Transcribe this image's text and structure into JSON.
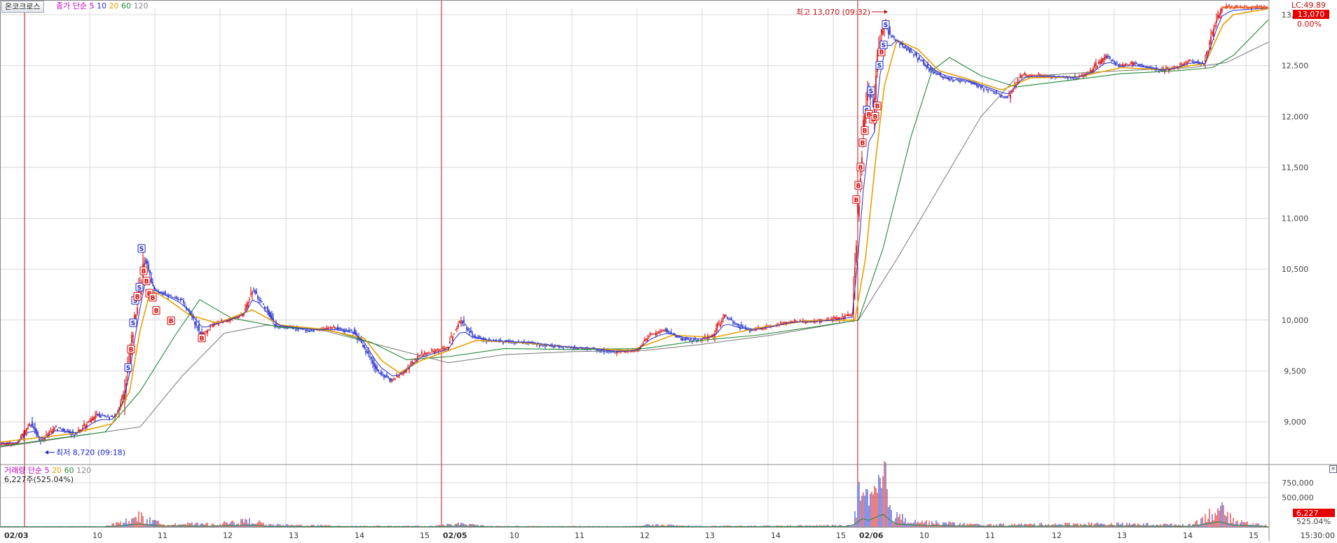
{
  "colors": {
    "up": "#d40000",
    "down": "#1a24c8",
    "ma5": "#2a2ed0",
    "ma10": "#d4d4d4",
    "ma20": "#e8a000",
    "ma60": "#22893a",
    "ma120": "#777777",
    "grid": "#d8d8d8",
    "day_line": "#c01010"
  },
  "price_panel": {
    "stock_button": "온코크로스",
    "legend": {
      "prefix": "종가",
      "type": "단순",
      "periods": [
        "5",
        "10",
        "20",
        "60",
        "120"
      ]
    },
    "right_top_label": "LC:49.89",
    "current_price_tag": "13,070",
    "current_pct": "0.00%",
    "high_label": "최고 13,070 (09:32)",
    "low_label": "최저 8,720 (09:18)"
  },
  "volume_panel": {
    "legend": {
      "prefix": "거래량",
      "type": "단순",
      "periods": [
        "5",
        "20",
        "60",
        "120"
      ]
    },
    "current_text": "6,227주(525.04%)",
    "tag_value": "6,227",
    "tag_pct": "525.04%"
  },
  "footer": {
    "end_time": "15:30:00"
  },
  "chart_data": {
    "type": "candlestick",
    "interval": "1-minute intraday (3 sessions)",
    "y_ticks": [
      9000,
      9500,
      10000,
      10500,
      11000,
      11500,
      12000,
      12500,
      13000
    ],
    "y_tick_labels": [
      "9,000",
      "9,500",
      "10,000",
      "10,500",
      "11,000",
      "11,500",
      "12,000",
      "12,500",
      "13,000"
    ],
    "ylim": [
      8600,
      13180
    ],
    "volume_ticks": [
      500000,
      750000
    ],
    "volume_tick_labels": [
      "500,000",
      "750,000"
    ],
    "volume_max": 1000000,
    "x_labels": [
      "02/03",
      "10",
      "11",
      "12",
      "13",
      "14",
      "15",
      "02/05",
      "10",
      "11",
      "12",
      "13",
      "14",
      "15",
      "02/06",
      "10",
      "11",
      "12",
      "13",
      "14",
      "15"
    ],
    "sessions": [
      "02/03",
      "02/05",
      "02/06"
    ],
    "high": {
      "value": 13070,
      "time": "09:32",
      "date": "02/06"
    },
    "low": {
      "value": 8720,
      "time": "09:18",
      "date": "02/03"
    },
    "price_path": [
      [
        0,
        8780
      ],
      [
        25,
        8780
      ],
      [
        45,
        8990
      ],
      [
        60,
        8800
      ],
      [
        80,
        8950
      ],
      [
        110,
        8880
      ],
      [
        140,
        9070
      ],
      [
        165,
        9050
      ],
      [
        178,
        9250
      ],
      [
        192,
        9950
      ],
      [
        202,
        10350
      ],
      [
        207,
        10600
      ],
      [
        213,
        10500
      ],
      [
        222,
        10300
      ],
      [
        240,
        10250
      ],
      [
        260,
        10200
      ],
      [
        275,
        10050
      ],
      [
        290,
        9850
      ],
      [
        305,
        9950
      ],
      [
        330,
        10000
      ],
      [
        350,
        10050
      ],
      [
        362,
        10300
      ],
      [
        378,
        10150
      ],
      [
        395,
        9950
      ],
      [
        420,
        9920
      ],
      [
        450,
        9900
      ],
      [
        480,
        9920
      ],
      [
        505,
        9900
      ],
      [
        520,
        9750
      ],
      [
        540,
        9500
      ],
      [
        560,
        9400
      ],
      [
        580,
        9500
      ],
      [
        600,
        9650
      ],
      [
        620,
        9690
      ],
      [
        640,
        9720
      ],
      [
        650,
        9900
      ],
      [
        660,
        10000
      ],
      [
        675,
        9850
      ],
      [
        700,
        9800
      ],
      [
        730,
        9790
      ],
      [
        760,
        9780
      ],
      [
        800,
        9740
      ],
      [
        850,
        9720
      ],
      [
        880,
        9680
      ],
      [
        910,
        9700
      ],
      [
        930,
        9850
      ],
      [
        950,
        9900
      ],
      [
        975,
        9820
      ],
      [
        1000,
        9800
      ],
      [
        1020,
        9850
      ],
      [
        1035,
        10050
      ],
      [
        1055,
        9950
      ],
      [
        1075,
        9900
      ],
      [
        1100,
        9930
      ],
      [
        1130,
        9980
      ],
      [
        1160,
        9980
      ],
      [
        1190,
        10000
      ],
      [
        1218,
        10050
      ],
      [
        1225,
        11000
      ],
      [
        1232,
        11800
      ],
      [
        1240,
        12300
      ],
      [
        1248,
        12100
      ],
      [
        1255,
        12700
      ],
      [
        1265,
        12950
      ],
      [
        1272,
        12800
      ],
      [
        1290,
        12700
      ],
      [
        1310,
        12600
      ],
      [
        1330,
        12450
      ],
      [
        1350,
        12380
      ],
      [
        1380,
        12350
      ],
      [
        1400,
        12300
      ],
      [
        1420,
        12250
      ],
      [
        1440,
        12180
      ],
      [
        1460,
        12400
      ],
      [
        1500,
        12400
      ],
      [
        1540,
        12380
      ],
      [
        1560,
        12450
      ],
      [
        1580,
        12600
      ],
      [
        1600,
        12500
      ],
      [
        1620,
        12520
      ],
      [
        1660,
        12450
      ],
      [
        1680,
        12480
      ],
      [
        1700,
        12550
      ],
      [
        1720,
        12520
      ],
      [
        1735,
        12900
      ],
      [
        1745,
        13070
      ],
      [
        1810,
        13070
      ]
    ],
    "ma20_path": [
      [
        0,
        8800
      ],
      [
        100,
        8880
      ],
      [
        160,
        8980
      ],
      [
        185,
        9300
      ],
      [
        200,
        9900
      ],
      [
        215,
        10300
      ],
      [
        240,
        10200
      ],
      [
        270,
        10050
      ],
      [
        310,
        9970
      ],
      [
        360,
        10100
      ],
      [
        400,
        9950
      ],
      [
        460,
        9910
      ],
      [
        520,
        9820
      ],
      [
        545,
        9600
      ],
      [
        570,
        9480
      ],
      [
        600,
        9600
      ],
      [
        640,
        9700
      ],
      [
        680,
        9800
      ],
      [
        740,
        9780
      ],
      [
        820,
        9730
      ],
      [
        900,
        9700
      ],
      [
        960,
        9850
      ],
      [
        1020,
        9830
      ],
      [
        1080,
        9920
      ],
      [
        1150,
        9990
      ],
      [
        1220,
        10000
      ],
      [
        1235,
        10600
      ],
      [
        1250,
        11600
      ],
      [
        1262,
        12300
      ],
      [
        1280,
        12750
      ],
      [
        1310,
        12660
      ],
      [
        1340,
        12450
      ],
      [
        1380,
        12370
      ],
      [
        1430,
        12260
      ],
      [
        1470,
        12380
      ],
      [
        1540,
        12390
      ],
      [
        1600,
        12480
      ],
      [
        1660,
        12460
      ],
      [
        1720,
        12520
      ],
      [
        1745,
        12900
      ],
      [
        1760,
        13000
      ],
      [
        1810,
        13060
      ]
    ],
    "ma60_path": [
      [
        0,
        8760
      ],
      [
        150,
        8900
      ],
      [
        200,
        9300
      ],
      [
        250,
        9850
      ],
      [
        285,
        10200
      ],
      [
        330,
        10020
      ],
      [
        400,
        9930
      ],
      [
        470,
        9900
      ],
      [
        530,
        9780
      ],
      [
        580,
        9610
      ],
      [
        640,
        9640
      ],
      [
        720,
        9720
      ],
      [
        820,
        9710
      ],
      [
        920,
        9720
      ],
      [
        1000,
        9800
      ],
      [
        1080,
        9850
      ],
      [
        1160,
        9930
      ],
      [
        1225,
        10000
      ],
      [
        1260,
        10700
      ],
      [
        1300,
        11800
      ],
      [
        1330,
        12450
      ],
      [
        1355,
        12580
      ],
      [
        1400,
        12400
      ],
      [
        1450,
        12290
      ],
      [
        1520,
        12350
      ],
      [
        1600,
        12420
      ],
      [
        1680,
        12450
      ],
      [
        1730,
        12480
      ],
      [
        1760,
        12600
      ],
      [
        1810,
        12950
      ]
    ],
    "ma120_path": [
      [
        0,
        8750
      ],
      [
        200,
        8950
      ],
      [
        260,
        9450
      ],
      [
        320,
        9870
      ],
      [
        380,
        9950
      ],
      [
        460,
        9900
      ],
      [
        560,
        9720
      ],
      [
        640,
        9580
      ],
      [
        720,
        9660
      ],
      [
        820,
        9690
      ],
      [
        920,
        9700
      ],
      [
        1000,
        9760
      ],
      [
        1100,
        9850
      ],
      [
        1225,
        10000
      ],
      [
        1280,
        10600
      ],
      [
        1340,
        11300
      ],
      [
        1400,
        12000
      ],
      [
        1450,
        12380
      ],
      [
        1520,
        12420
      ],
      [
        1600,
        12450
      ],
      [
        1700,
        12480
      ],
      [
        1750,
        12530
      ],
      [
        1810,
        12730
      ]
    ],
    "volume_profile": [
      [
        0,
        8000
      ],
      [
        150,
        12000
      ],
      [
        185,
        120000
      ],
      [
        195,
        220000
      ],
      [
        205,
        160000
      ],
      [
        230,
        60000
      ],
      [
        300,
        50000
      ],
      [
        362,
        120000
      ],
      [
        380,
        40000
      ],
      [
        500,
        20000
      ],
      [
        620,
        15000
      ],
      [
        650,
        60000
      ],
      [
        700,
        15000
      ],
      [
        900,
        12000
      ],
      [
        930,
        40000
      ],
      [
        1000,
        15000
      ],
      [
        1100,
        20000
      ],
      [
        1218,
        30000
      ],
      [
        1225,
        600000
      ],
      [
        1240,
        450000
      ],
      [
        1262,
        900000
      ],
      [
        1275,
        200000
      ],
      [
        1320,
        90000
      ],
      [
        1400,
        40000
      ],
      [
        1560,
        60000
      ],
      [
        1700,
        40000
      ],
      [
        1740,
        350000
      ],
      [
        1760,
        120000
      ],
      [
        1810,
        20000
      ]
    ],
    "trade_markers": [
      {
        "kind": "S",
        "pos": 183,
        "price": 9530
      },
      {
        "kind": "B",
        "pos": 187,
        "price": 9710
      },
      {
        "kind": "S",
        "pos": 190,
        "price": 9970
      },
      {
        "kind": "S",
        "pos": 193,
        "price": 10190
      },
      {
        "kind": "B",
        "pos": 196,
        "price": 10230
      },
      {
        "kind": "S",
        "pos": 199,
        "price": 10320
      },
      {
        "kind": "S",
        "pos": 202,
        "price": 10700
      },
      {
        "kind": "B",
        "pos": 205,
        "price": 10480
      },
      {
        "kind": "B",
        "pos": 209,
        "price": 10380
      },
      {
        "kind": "B",
        "pos": 213,
        "price": 10260
      },
      {
        "kind": "B",
        "pos": 218,
        "price": 10220
      },
      {
        "kind": "B",
        "pos": 223,
        "price": 10090
      },
      {
        "kind": "B",
        "pos": 244,
        "price": 9990
      },
      {
        "kind": "B",
        "pos": 288,
        "price": 9820
      },
      {
        "kind": "B",
        "pos": 1222,
        "price": 11180
      },
      {
        "kind": "B",
        "pos": 1225,
        "price": 11320
      },
      {
        "kind": "B",
        "pos": 1228,
        "price": 11500
      },
      {
        "kind": "B",
        "pos": 1231,
        "price": 11740
      },
      {
        "kind": "B",
        "pos": 1234,
        "price": 11860
      },
      {
        "kind": "S",
        "pos": 1237,
        "price": 12060
      },
      {
        "kind": "B",
        "pos": 1240,
        "price": 12020
      },
      {
        "kind": "S",
        "pos": 1243,
        "price": 12250
      },
      {
        "kind": "B",
        "pos": 1246,
        "price": 11970
      },
      {
        "kind": "B",
        "pos": 1249,
        "price": 12000
      },
      {
        "kind": "B",
        "pos": 1252,
        "price": 12100
      },
      {
        "kind": "S",
        "pos": 1255,
        "price": 12500
      },
      {
        "kind": "B",
        "pos": 1258,
        "price": 12630
      },
      {
        "kind": "S",
        "pos": 1261,
        "price": 12700
      },
      {
        "kind": "S",
        "pos": 1264,
        "price": 12900
      }
    ]
  }
}
